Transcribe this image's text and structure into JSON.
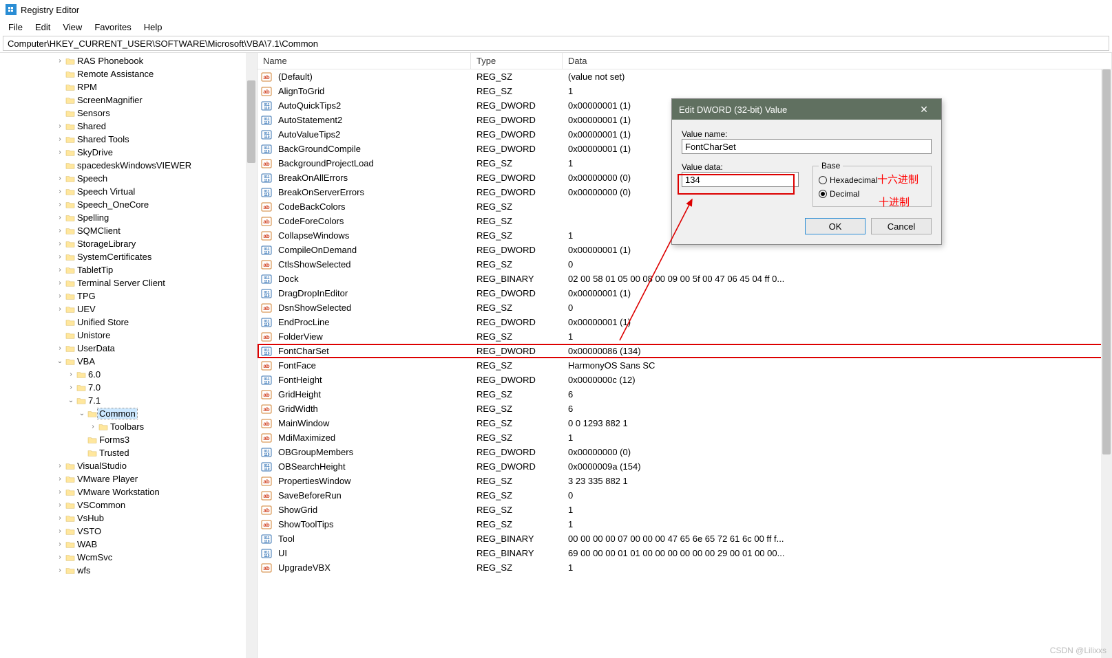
{
  "app": {
    "title": "Registry Editor"
  },
  "menu": {
    "file": "File",
    "edit": "Edit",
    "view": "View",
    "favorites": "Favorites",
    "help": "Help"
  },
  "address": "Computer\\HKEY_CURRENT_USER\\SOFTWARE\\Microsoft\\VBA\\7.1\\Common",
  "header": {
    "name": "Name",
    "type": "Type",
    "data": "Data"
  },
  "tree": [
    {
      "d": 5,
      "c": ">",
      "l": "RAS Phonebook"
    },
    {
      "d": 5,
      "c": "",
      "l": "Remote Assistance"
    },
    {
      "d": 5,
      "c": "",
      "l": "RPM"
    },
    {
      "d": 5,
      "c": "",
      "l": "ScreenMagnifier"
    },
    {
      "d": 5,
      "c": "",
      "l": "Sensors"
    },
    {
      "d": 5,
      "c": ">",
      "l": "Shared"
    },
    {
      "d": 5,
      "c": ">",
      "l": "Shared Tools"
    },
    {
      "d": 5,
      "c": ">",
      "l": "SkyDrive"
    },
    {
      "d": 5,
      "c": "",
      "l": "spacedeskWindowsVIEWER"
    },
    {
      "d": 5,
      "c": ">",
      "l": "Speech"
    },
    {
      "d": 5,
      "c": ">",
      "l": "Speech Virtual"
    },
    {
      "d": 5,
      "c": ">",
      "l": "Speech_OneCore"
    },
    {
      "d": 5,
      "c": ">",
      "l": "Spelling"
    },
    {
      "d": 5,
      "c": ">",
      "l": "SQMClient"
    },
    {
      "d": 5,
      "c": ">",
      "l": "StorageLibrary"
    },
    {
      "d": 5,
      "c": ">",
      "l": "SystemCertificates"
    },
    {
      "d": 5,
      "c": ">",
      "l": "TabletTip"
    },
    {
      "d": 5,
      "c": ">",
      "l": "Terminal Server Client"
    },
    {
      "d": 5,
      "c": ">",
      "l": "TPG"
    },
    {
      "d": 5,
      "c": ">",
      "l": "UEV"
    },
    {
      "d": 5,
      "c": "",
      "l": "Unified Store"
    },
    {
      "d": 5,
      "c": "",
      "l": "Unistore"
    },
    {
      "d": 5,
      "c": ">",
      "l": "UserData"
    },
    {
      "d": 5,
      "c": "v",
      "l": "VBA"
    },
    {
      "d": 6,
      "c": ">",
      "l": "6.0"
    },
    {
      "d": 6,
      "c": ">",
      "l": "7.0"
    },
    {
      "d": 6,
      "c": "v",
      "l": "7.1"
    },
    {
      "d": 7,
      "c": "v",
      "l": "Common",
      "sel": true
    },
    {
      "d": 8,
      "c": ">",
      "l": "Toolbars"
    },
    {
      "d": 7,
      "c": "",
      "l": "Forms3"
    },
    {
      "d": 7,
      "c": "",
      "l": "Trusted"
    },
    {
      "d": 5,
      "c": ">",
      "l": "VisualStudio"
    },
    {
      "d": 5,
      "c": ">",
      "l": "VMware Player"
    },
    {
      "d": 5,
      "c": ">",
      "l": "VMware Workstation"
    },
    {
      "d": 5,
      "c": ">",
      "l": "VSCommon"
    },
    {
      "d": 5,
      "c": ">",
      "l": "VsHub"
    },
    {
      "d": 5,
      "c": ">",
      "l": "VSTO"
    },
    {
      "d": 5,
      "c": ">",
      "l": "WAB"
    },
    {
      "d": 5,
      "c": ">",
      "l": "WcmSvc"
    },
    {
      "d": 5,
      "c": ">",
      "l": "wfs"
    }
  ],
  "rows": [
    {
      "i": "s",
      "n": "(Default)",
      "t": "REG_SZ",
      "v": "(value not set)"
    },
    {
      "i": "s",
      "n": "AlignToGrid",
      "t": "REG_SZ",
      "v": "1"
    },
    {
      "i": "d",
      "n": "AutoQuickTips2",
      "t": "REG_DWORD",
      "v": "0x00000001 (1)"
    },
    {
      "i": "d",
      "n": "AutoStatement2",
      "t": "REG_DWORD",
      "v": "0x00000001 (1)"
    },
    {
      "i": "d",
      "n": "AutoValueTips2",
      "t": "REG_DWORD",
      "v": "0x00000001 (1)"
    },
    {
      "i": "d",
      "n": "BackGroundCompile",
      "t": "REG_DWORD",
      "v": "0x00000001 (1)"
    },
    {
      "i": "s",
      "n": "BackgroundProjectLoad",
      "t": "REG_SZ",
      "v": "1"
    },
    {
      "i": "d",
      "n": "BreakOnAllErrors",
      "t": "REG_DWORD",
      "v": "0x00000000 (0)"
    },
    {
      "i": "d",
      "n": "BreakOnServerErrors",
      "t": "REG_DWORD",
      "v": "0x00000000 (0)"
    },
    {
      "i": "s",
      "n": "CodeBackColors",
      "t": "REG_SZ",
      "v": ""
    },
    {
      "i": "s",
      "n": "CodeForeColors",
      "t": "REG_SZ",
      "v": ""
    },
    {
      "i": "s",
      "n": "CollapseWindows",
      "t": "REG_SZ",
      "v": "1"
    },
    {
      "i": "d",
      "n": "CompileOnDemand",
      "t": "REG_DWORD",
      "v": "0x00000001 (1)"
    },
    {
      "i": "s",
      "n": "CtlsShowSelected",
      "t": "REG_SZ",
      "v": "0"
    },
    {
      "i": "d",
      "n": "Dock",
      "t": "REG_BINARY",
      "v": "02 00 58 01 05 00 08 00 09 00 5f 00 47 06 45 04 ff 0..."
    },
    {
      "i": "d",
      "n": "DragDropInEditor",
      "t": "REG_DWORD",
      "v": "0x00000001 (1)"
    },
    {
      "i": "s",
      "n": "DsnShowSelected",
      "t": "REG_SZ",
      "v": "0"
    },
    {
      "i": "d",
      "n": "EndProcLine",
      "t": "REG_DWORD",
      "v": "0x00000001 (1)"
    },
    {
      "i": "s",
      "n": "FolderView",
      "t": "REG_SZ",
      "v": "1"
    },
    {
      "i": "d",
      "n": "FontCharSet",
      "t": "REG_DWORD",
      "v": "0x00000086 (134)",
      "hi": true
    },
    {
      "i": "s",
      "n": "FontFace",
      "t": "REG_SZ",
      "v": "HarmonyOS Sans SC"
    },
    {
      "i": "d",
      "n": "FontHeight",
      "t": "REG_DWORD",
      "v": "0x0000000c (12)"
    },
    {
      "i": "s",
      "n": "GridHeight",
      "t": "REG_SZ",
      "v": "6"
    },
    {
      "i": "s",
      "n": "GridWidth",
      "t": "REG_SZ",
      "v": "6"
    },
    {
      "i": "s",
      "n": "MainWindow",
      "t": "REG_SZ",
      "v": "0 0 1293 882 1"
    },
    {
      "i": "s",
      "n": "MdiMaximized",
      "t": "REG_SZ",
      "v": "1"
    },
    {
      "i": "d",
      "n": "OBGroupMembers",
      "t": "REG_DWORD",
      "v": "0x00000000 (0)"
    },
    {
      "i": "d",
      "n": "OBSearchHeight",
      "t": "REG_DWORD",
      "v": "0x0000009a (154)"
    },
    {
      "i": "s",
      "n": "PropertiesWindow",
      "t": "REG_SZ",
      "v": "3 23 335 882 1"
    },
    {
      "i": "s",
      "n": "SaveBeforeRun",
      "t": "REG_SZ",
      "v": "0"
    },
    {
      "i": "s",
      "n": "ShowGrid",
      "t": "REG_SZ",
      "v": "1"
    },
    {
      "i": "s",
      "n": "ShowToolTips",
      "t": "REG_SZ",
      "v": "1"
    },
    {
      "i": "d",
      "n": "Tool",
      "t": "REG_BINARY",
      "v": "00 00 00 00 07 00 00 00 47 65 6e 65 72 61 6c 00 ff f..."
    },
    {
      "i": "d",
      "n": "UI",
      "t": "REG_BINARY",
      "v": "69 00 00 00 01 01 00 00 00 00 00 00 29 00 01 00 00..."
    },
    {
      "i": "s",
      "n": "UpgradeVBX",
      "t": "REG_SZ",
      "v": "1"
    }
  ],
  "dialog": {
    "title": "Edit DWORD (32-bit) Value",
    "valueNameLabel": "Value name:",
    "valueName": "FontCharSet",
    "valueDataLabel": "Value data:",
    "valueData": "134",
    "baseLabel": "Base",
    "hex": "Hexadecimal",
    "dec": "Decimal",
    "ok": "OK",
    "cancel": "Cancel"
  },
  "anno": {
    "hex": "十六进制",
    "dec": "十进制"
  },
  "watermark": "CSDN @Lilixxs"
}
